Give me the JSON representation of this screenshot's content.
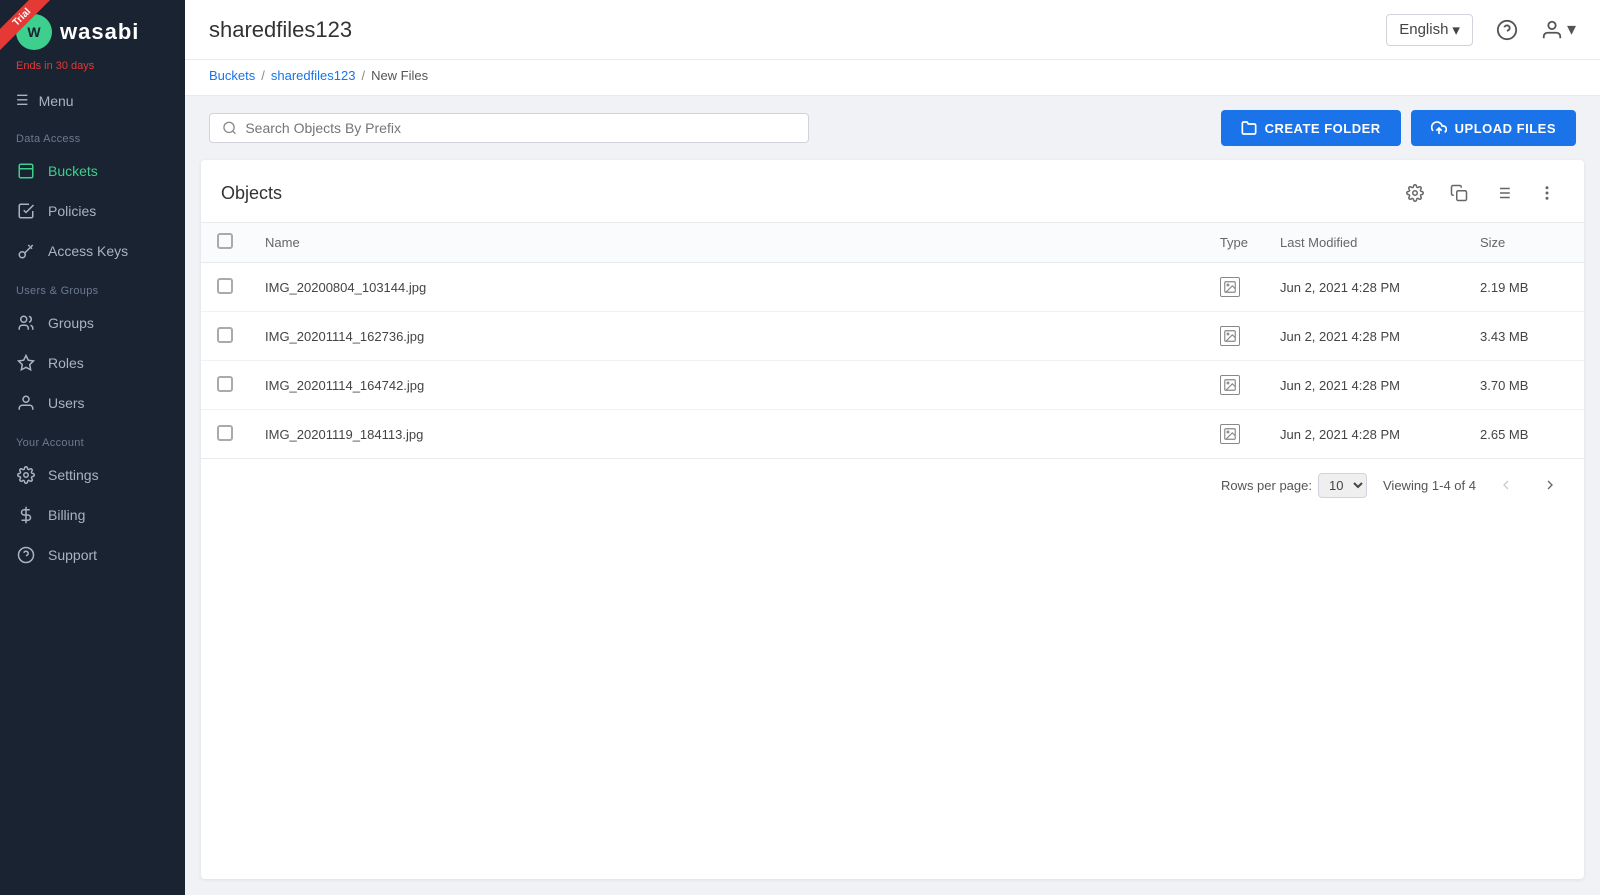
{
  "sidebar": {
    "logo_text": "wasabi",
    "trial_text": "Ends in 30 days",
    "menu_label": "Menu",
    "data_access_label": "Data Access",
    "users_groups_label": "Users & Groups",
    "your_account_label": "Your Account",
    "items": [
      {
        "id": "buckets",
        "label": "Buckets",
        "icon": "🗂",
        "active": true,
        "section": "data_access"
      },
      {
        "id": "policies",
        "label": "Policies",
        "icon": "📋",
        "active": false,
        "section": "data_access"
      },
      {
        "id": "access-keys",
        "label": "Access Keys",
        "icon": "🔑",
        "active": false,
        "section": "data_access"
      },
      {
        "id": "groups",
        "label": "Groups",
        "icon": "👥",
        "active": false,
        "section": "users_groups"
      },
      {
        "id": "roles",
        "label": "Roles",
        "icon": "🛡",
        "active": false,
        "section": "users_groups"
      },
      {
        "id": "users",
        "label": "Users",
        "icon": "👤",
        "active": false,
        "section": "users_groups"
      },
      {
        "id": "settings",
        "label": "Settings",
        "icon": "⚙",
        "active": false,
        "section": "your_account"
      },
      {
        "id": "billing",
        "label": "Billing",
        "icon": "💲",
        "active": false,
        "section": "your_account"
      },
      {
        "id": "support",
        "label": "Support",
        "icon": "❓",
        "active": false,
        "section": "your_account"
      }
    ]
  },
  "topbar": {
    "title": "sharedfiles123",
    "language": "English",
    "language_dropdown_icon": "▾"
  },
  "breadcrumb": {
    "items": [
      {
        "label": "Buckets",
        "link": true
      },
      {
        "label": "sharedfiles123",
        "link": true
      },
      {
        "label": "New Files",
        "link": false
      }
    ]
  },
  "toolbar": {
    "search_placeholder": "Search Objects By Prefix",
    "create_folder_label": "CREATE FOLDER",
    "upload_files_label": "UPLOAD FILES"
  },
  "objects": {
    "title": "Objects",
    "columns": {
      "name": "Name",
      "type": "Type",
      "last_modified": "Last Modified",
      "size": "Size"
    },
    "rows": [
      {
        "name": "IMG_20200804_103144.jpg",
        "type": "image",
        "last_modified": "Jun 2, 2021 4:28 PM",
        "size": "2.19 MB"
      },
      {
        "name": "IMG_20201114_162736.jpg",
        "type": "image",
        "last_modified": "Jun 2, 2021 4:28 PM",
        "size": "3.43 MB"
      },
      {
        "name": "IMG_20201114_164742.jpg",
        "type": "image",
        "last_modified": "Jun 2, 2021 4:28 PM",
        "size": "3.70 MB"
      },
      {
        "name": "IMG_20201119_184113.jpg",
        "type": "image",
        "last_modified": "Jun 2, 2021 4:28 PM",
        "size": "2.65 MB"
      }
    ],
    "pagination": {
      "rows_per_page_label": "Rows per page:",
      "rows_per_page_value": "10",
      "viewing_label": "Viewing 1-4 of 4"
    }
  }
}
